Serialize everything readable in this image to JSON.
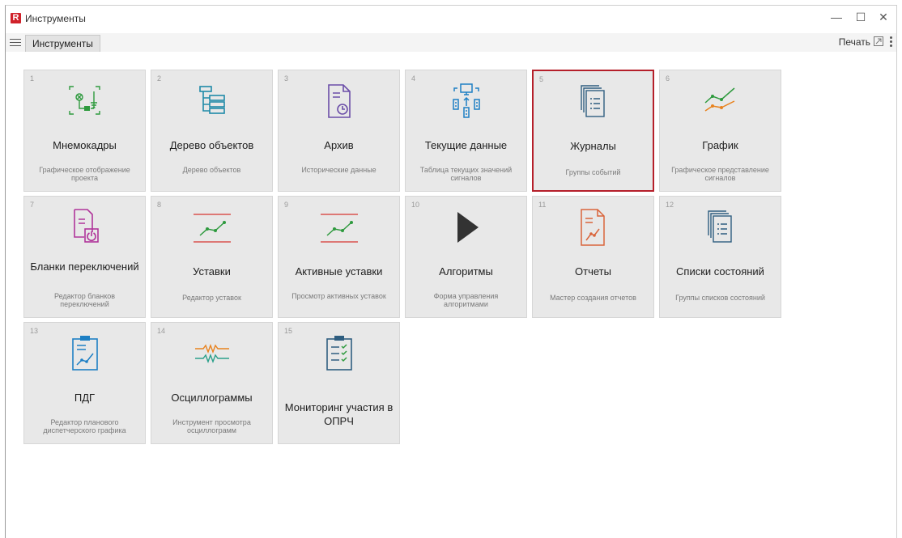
{
  "window": {
    "title": "Инструменты"
  },
  "menubar": {
    "tab_label": "Инструменты",
    "print_label": "Печать"
  },
  "colors": {
    "selected_border": "#b51f2a",
    "tile_bg": "#e8e8e8"
  },
  "tiles": [
    {
      "num": "1",
      "title": "Мнемокадры",
      "desc": "Графическое отображение проекта",
      "icon": "mnemo-icon"
    },
    {
      "num": "2",
      "title": "Дерево объектов",
      "desc": "Дерево объектов",
      "icon": "tree-icon"
    },
    {
      "num": "3",
      "title": "Архив",
      "desc": "Исторические данные",
      "icon": "archive-icon"
    },
    {
      "num": "4",
      "title": "Текущие данные",
      "desc": "Таблица текущих значений сигналов",
      "icon": "current-data-icon"
    },
    {
      "num": "5",
      "title": "Журналы",
      "desc": "Группы событий",
      "icon": "journals-icon"
    },
    {
      "num": "6",
      "title": "График",
      "desc": "Графическое представление сигналов",
      "icon": "chart-icon"
    },
    {
      "num": "7",
      "title": "Бланки переключений",
      "desc": "Редактор бланков переключений",
      "icon": "switch-forms-icon"
    },
    {
      "num": "8",
      "title": "Уставки",
      "desc": "Редактор уставок",
      "icon": "setpoints-icon"
    },
    {
      "num": "9",
      "title": "Активные уставки",
      "desc": "Просмотр активных уставок",
      "icon": "active-setpoints-icon"
    },
    {
      "num": "10",
      "title": "Алгоритмы",
      "desc": "Форма управления алгоритмами",
      "icon": "play-icon"
    },
    {
      "num": "11",
      "title": "Отчеты",
      "desc": "Мастер создания отчетов",
      "icon": "reports-icon"
    },
    {
      "num": "12",
      "title": "Списки состояний",
      "desc": "Группы списков состояний",
      "icon": "state-lists-icon"
    },
    {
      "num": "13",
      "title": "ПДГ",
      "desc": "Редактор планового диспетчерского графика",
      "icon": "pdg-icon"
    },
    {
      "num": "14",
      "title": "Осциллограммы",
      "desc": "Инструмент просмотра осциллограмм",
      "icon": "oscillogram-icon"
    },
    {
      "num": "15",
      "title": "Мониторинг участия в ОПРЧ",
      "desc": "",
      "icon": "monitoring-checklist-icon"
    }
  ]
}
